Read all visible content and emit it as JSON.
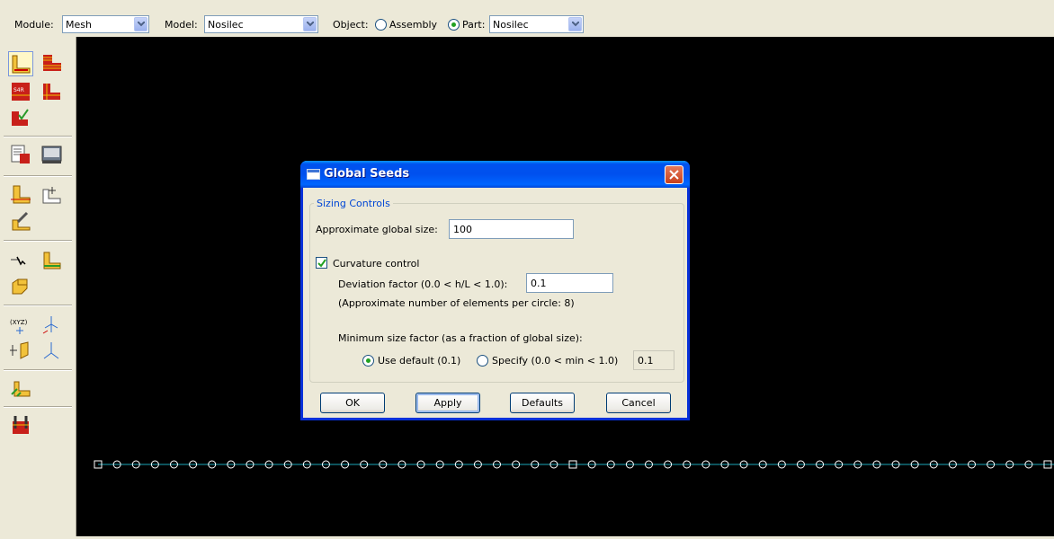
{
  "context_bar": {
    "module_label": "Module:",
    "module_value": "Mesh",
    "model_label": "Model:",
    "model_value": "Nosilec",
    "object_label": "Object:",
    "assembly_label": "Assembly",
    "part_label": "Part:",
    "part_value": "Nosilec",
    "object_selected": "Part"
  },
  "toolbox": {
    "tools": [
      "seed-part-tool",
      "seed-edge-tool",
      "mesh-element-type-tool",
      "mesh-part-tool",
      "verify-mesh-tool",
      "mesh-controls-tool",
      "display-tool",
      "partition-face-tool",
      "partition-cell-tool",
      "edit-mesh-tool",
      "virtual-topology-tool",
      "assign-stack-tool",
      "datum-point-tool",
      "datum-axis-tool",
      "datum-plane-tool",
      "datum-csys-tool",
      "create-surface-tool",
      "query-tool"
    ]
  },
  "dialog": {
    "title": "Global Seeds",
    "group_label": "Sizing Controls",
    "approx_size_label": "Approximate global size:",
    "approx_size_value": "100",
    "curvature_label": "Curvature control",
    "curvature_checked": true,
    "deviation_label": "Deviation factor (0.0 < h/L < 1.0):",
    "deviation_value": "0.1",
    "elements_note": "(Approximate number of elements per circle: 8)",
    "min_size_label": "Minimum size factor (as a fraction of global size):",
    "use_default_label": "Use default (0.1)",
    "specify_label": "Specify (0.0 < min < 1.0)",
    "specify_value": "0.1",
    "min_size_selected": "Use default",
    "buttons": {
      "ok": "OK",
      "apply": "Apply",
      "defaults": "Defaults",
      "cancel": "Cancel"
    }
  },
  "viewport": {
    "background": "#000000",
    "edge_color": "#1aa6b8",
    "seed_color": "#ffffff"
  }
}
